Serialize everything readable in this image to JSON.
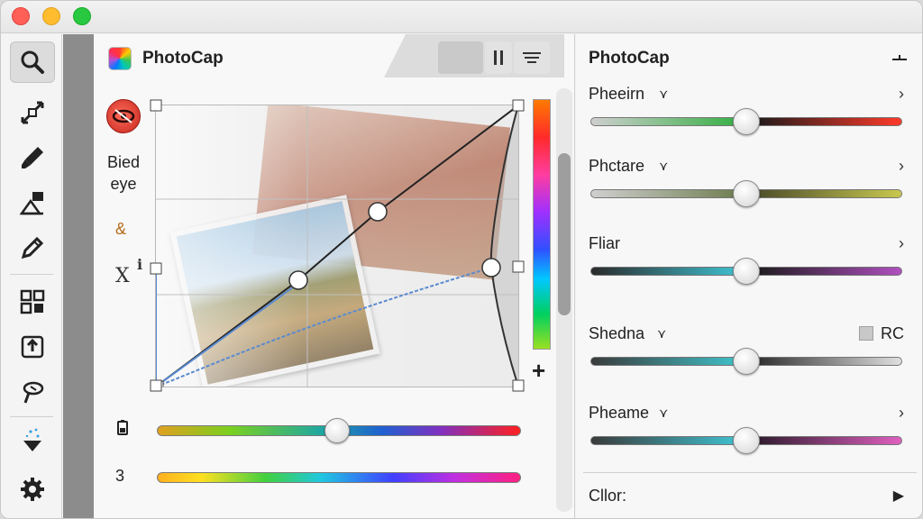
{
  "window": {
    "title_controls": [
      "close",
      "minimize",
      "zoom"
    ]
  },
  "toolbar": {
    "tools": [
      {
        "name": "zoom-tool",
        "icon": "magnifier-icon",
        "active": true
      },
      {
        "name": "transform-tool",
        "icon": "resize-arrows-icon"
      },
      {
        "name": "brush-tool",
        "icon": "brush-icon"
      },
      {
        "name": "shapes-tool",
        "icon": "shapes-icon"
      },
      {
        "name": "pencil-tool",
        "icon": "pencil-icon"
      },
      {
        "name": "layout-tool",
        "icon": "grid-layout-icon"
      },
      {
        "name": "export-tool",
        "icon": "export-box-icon"
      },
      {
        "name": "lasso-tool",
        "icon": "lasso-icon"
      },
      {
        "name": "fill-tool",
        "icon": "sparkle-fill-icon"
      },
      {
        "name": "settings-tool",
        "icon": "gear-icon"
      }
    ]
  },
  "center": {
    "app_title": "PhotoCap",
    "side": {
      "redeye_label": "Bied eye",
      "symbol": "&",
      "x_label": "X",
      "i_label": "i"
    },
    "sliders": [
      {
        "label": "",
        "icon": "battery-icon",
        "value": 0.5
      },
      {
        "label": "3",
        "value": null
      }
    ],
    "plus": "+"
  },
  "right": {
    "title": "PhotoCap",
    "adjustments": [
      {
        "label": "Pheeirn",
        "caret": "⋎",
        "chevron": "›",
        "value": 0.5,
        "colors": [
          "#cfcfcf",
          "#2fae3e",
          "#1a1a1a",
          "#ff3a2a"
        ]
      },
      {
        "label": "Phctare",
        "caret": "⋎",
        "chevron": "›",
        "value": 0.5,
        "colors": [
          "#d0d0d0",
          "#6a7a4a",
          "#4a4a2a",
          "#c8c850"
        ]
      },
      {
        "label": "Fliar",
        "caret": "",
        "chevron": "›",
        "value": 0.5,
        "colors": [
          "#2a2a2a",
          "#40c8d8",
          "#1a1a1a",
          "#b050c0"
        ]
      },
      {
        "label": "Shedna",
        "caret": "⋎",
        "chevron": "",
        "value": 0.5,
        "colors": [
          "#3a3a3a",
          "#40c8d0",
          "#2a2a2a",
          "#e0e0e0"
        ],
        "extra_checkbox": "RC"
      },
      {
        "label": "Pheame",
        "caret": "⋎",
        "chevron": "›",
        "value": 0.5,
        "colors": [
          "#3a3a3a",
          "#40c8d8",
          "#2a1a2a",
          "#e060c0"
        ]
      }
    ],
    "color_label": "Cllor:",
    "color_play": "▶"
  }
}
